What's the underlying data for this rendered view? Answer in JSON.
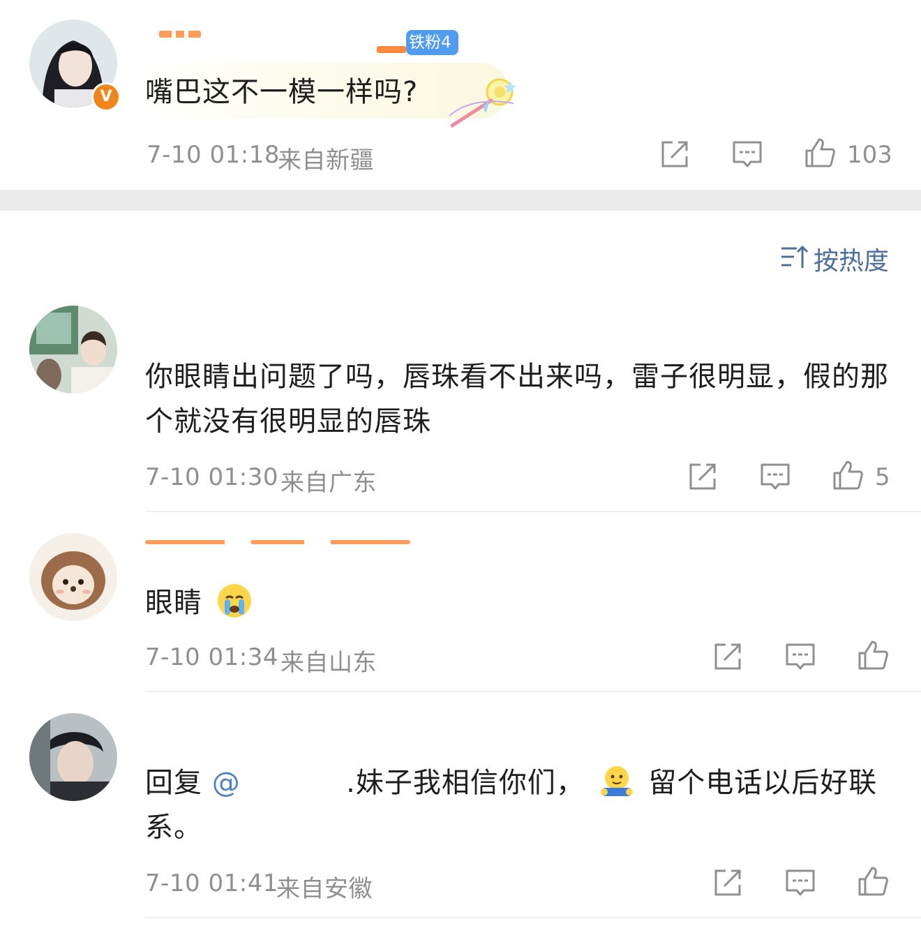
{
  "pinned_comment": {
    "fan_badge": "铁粉4",
    "text": "嘴巴这不一模一样吗?",
    "time": "7-10 01:18",
    "location": "来自新疆",
    "like_count": "103"
  },
  "sort": {
    "label": "按热度"
  },
  "comments": [
    {
      "text": "你眼睛出问题了吗，唇珠看不出来吗，雷子很明显，假的那个就没有很明显的唇珠",
      "time": "7-10 01:30",
      "location": "来自广东",
      "like_count": "5"
    },
    {
      "text": "眼睛",
      "emoji": "crying-face",
      "time": "7-10 01:34",
      "location": "来自山东",
      "like_count": ""
    },
    {
      "reply_prefix": "回复",
      "mention": "@",
      "text_after_mention": ".妹子我相信你们，",
      "text_end": "留个电话以后好联系。",
      "time": "7-10 01:41",
      "location": "来自安徽",
      "like_count": ""
    }
  ],
  "icons": [
    "share-icon",
    "comment-icon",
    "like-icon",
    "sort-icon",
    "verified-v-icon"
  ],
  "colors": {
    "meta_gray": "#8f8f8f",
    "link_blue": "#4c82c3",
    "badge_blue": "#4f9cf1",
    "verified_orange": "#f08519",
    "divider": "#eeeeee"
  }
}
